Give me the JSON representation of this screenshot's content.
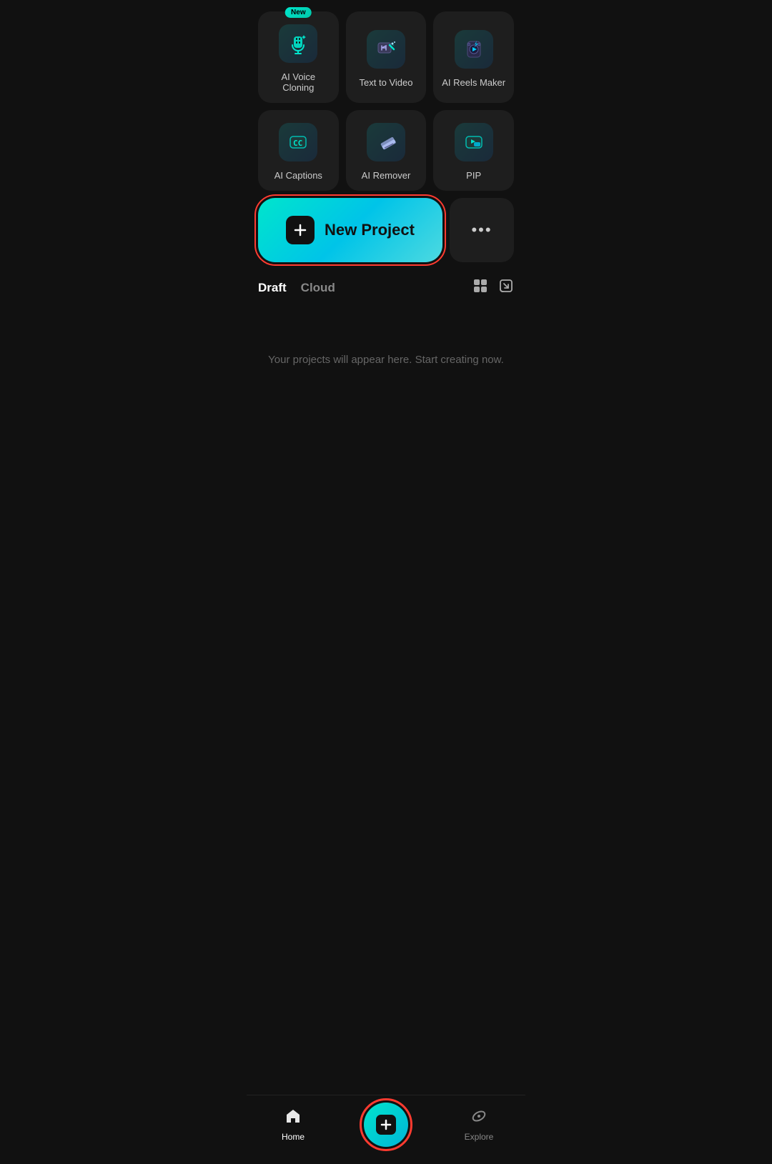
{
  "tools": [
    {
      "id": "ai-voice-cloning",
      "label": "AI Voice Cloning",
      "isNew": true,
      "iconType": "voice"
    },
    {
      "id": "text-to-video",
      "label": "Text to Video",
      "isNew": false,
      "iconType": "video-edit"
    },
    {
      "id": "ai-reels-maker",
      "label": "AI Reels Maker",
      "isNew": false,
      "iconType": "bolt"
    },
    {
      "id": "ai-captions",
      "label": "AI Captions",
      "isNew": false,
      "iconType": "cc"
    },
    {
      "id": "ai-remover",
      "label": "AI Remover",
      "isNew": false,
      "iconType": "eraser"
    },
    {
      "id": "pip",
      "label": "PIP",
      "isNew": false,
      "iconType": "pip"
    }
  ],
  "new_badge_label": "New",
  "new_project_label": "New Project",
  "more_dots": "•••",
  "tabs": [
    {
      "id": "draft",
      "label": "Draft",
      "active": true
    },
    {
      "id": "cloud",
      "label": "Cloud",
      "active": false
    }
  ],
  "empty_state_text": "Your projects will appear here. Start creating now.",
  "nav": {
    "home_label": "Home",
    "explore_label": "Explore"
  }
}
